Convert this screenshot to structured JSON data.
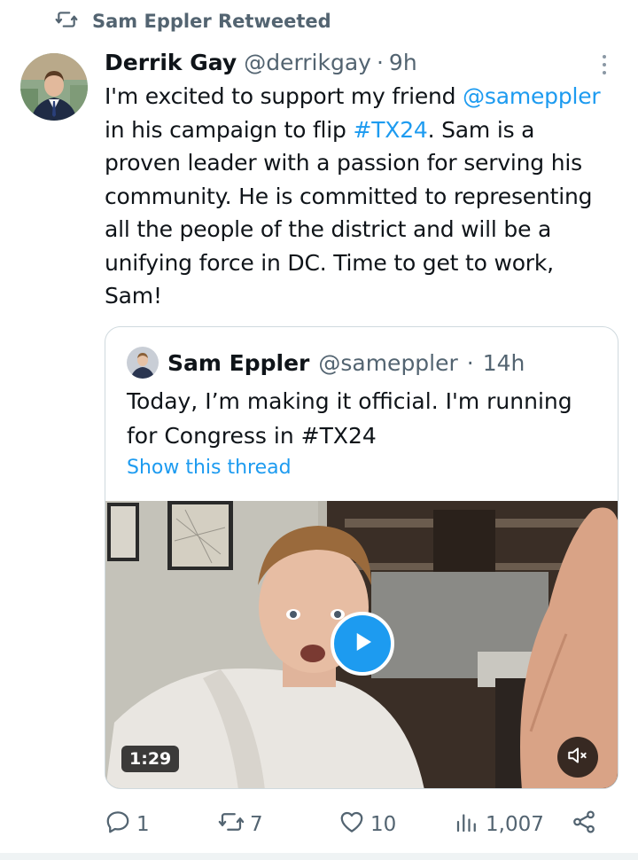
{
  "retweet": {
    "label": "Sam Eppler Retweeted",
    "icon": "retweet-icon"
  },
  "tweet": {
    "author_name": "Derrik Gay",
    "author_handle": "@derrikgay",
    "separator": "·",
    "time": "9h",
    "body": {
      "line1_prefix": "I'm excited to support my friend ",
      "line1_mention": "@sameppler",
      "line2_prefix": "in his campaign to flip ",
      "line2_hashtag": "#TX24",
      "line2_suffix": ". Sam is a",
      "line3": "proven leader with a passion for serving his",
      "line4": "community. He is committed to representing",
      "line5": "all the people of the district and will be a",
      "line6": "unifying force in DC. Time to get to work,",
      "line7": "Sam!"
    }
  },
  "quote": {
    "author_name": "Sam Eppler",
    "author_handle": "@sameppler",
    "separator": "·",
    "time": "14h",
    "line1": "Today, I’m making it official. I'm running",
    "line2_prefix": "for Congress in ",
    "line2_hashtag": "#TX24",
    "show_thread": "Show this thread",
    "video": {
      "duration": "1:29",
      "play_icon": "play-icon",
      "mute_icon": "mute-icon"
    }
  },
  "actions": {
    "replies": "1",
    "retweets": "7",
    "likes": "10",
    "views": "1,007",
    "icons": [
      "reply-icon",
      "retweet-icon",
      "heart-icon",
      "views-icon",
      "share-icon"
    ]
  },
  "colors": {
    "accent": "#1d9bf0",
    "secondary_text": "#536471",
    "text": "#0f1419",
    "border": "#cfd9de"
  }
}
